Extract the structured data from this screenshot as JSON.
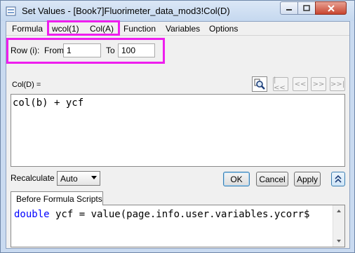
{
  "window": {
    "title": "Set Values - [Book7]Fluorimeter_data_mod3!Col(D)"
  },
  "menu": [
    "Formula",
    "wcol(1)",
    "Col(A)",
    "Function",
    "Variables",
    "Options"
  ],
  "row_range": {
    "label": "Row (i):",
    "from_label": "From",
    "from_value": "1",
    "to_label": "To",
    "to_value": "100"
  },
  "formula": {
    "label": "Col(D) =",
    "text": "col(b) + ycf"
  },
  "nav_buttons": [
    "|<<",
    "<<",
    ">>",
    ">>|"
  ],
  "recalculate": {
    "label": "Recalculate",
    "value": "Auto"
  },
  "buttons": {
    "ok": "OK",
    "cancel": "Cancel",
    "apply": "Apply"
  },
  "scripts_tab": {
    "label": "Before Formula Scripts",
    "keyword": "double",
    "rest": " ycf = value(page.info.user.variables.ycorr$"
  },
  "colors": {
    "highlight": "#ee1eee",
    "keyword": "#0000ff",
    "title_bar": "#c9daf0"
  }
}
